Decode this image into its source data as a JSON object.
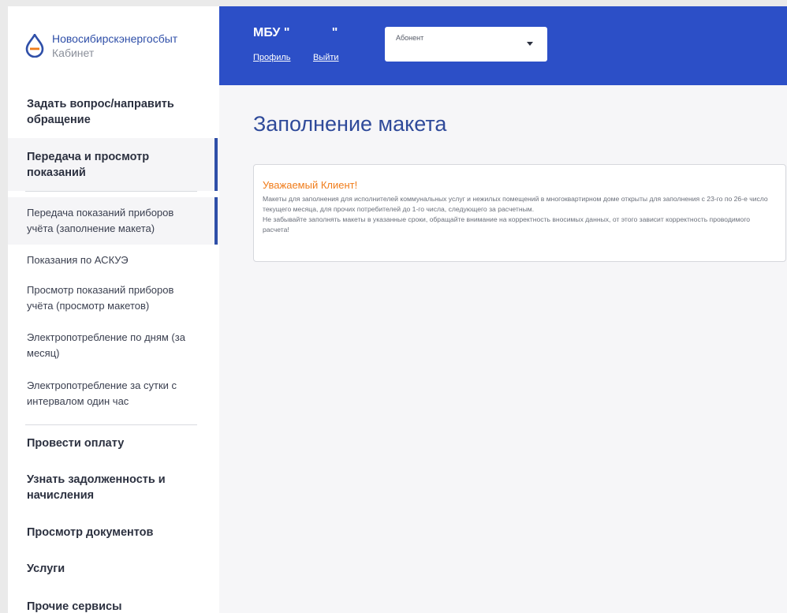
{
  "brand": {
    "name": "Новосибирскэнергосбыт",
    "subtitle": "Кабинет",
    "icon": "drop-logo-icon"
  },
  "header": {
    "org_name": "МБУ \"            \"",
    "profile_link": "Профиль",
    "logout_link": "Выйти",
    "account_select": {
      "value": "Абонент",
      "icon": "chevron-down-icon"
    }
  },
  "sidebar": {
    "ask_question": "Задать вопрос/направить обращение",
    "readings_section": "Передача и просмотр показаний",
    "sub_items": [
      "Передача показаний приборов учёта (заполнение макета)",
      "Показания по АСКУЭ",
      "Просмотр показаний приборов учёта (просмотр макетов)",
      "Электропотребление по дням (за месяц)",
      "Электропотребление за сутки с интервалом один час"
    ],
    "bottom_items": [
      "Провести оплату",
      "Узнать задолженность и начисления",
      "Просмотр документов",
      "Услуги",
      "Прочие сервисы"
    ]
  },
  "main": {
    "title": "Заполнение макета",
    "notice": {
      "title": "Уважаемый Клиент!",
      "text_1": "Макеты для заполнения для исполнителей коммунальных услуг и нежилых помещений в многоквартирном доме открыты для заполнения с 23-го по 26-е число текущего месяца, для прочих потребителей до 1-го числа, следующего за расчетным.",
      "text_2": "Не забывайте заполнять макеты в указанные сроки, обращайте внимание на корректность вносимых данных, от этого зависит корректность проводимого расчета!"
    }
  },
  "colors": {
    "header_bg": "#2c4fc7",
    "accent": "#2f4fa8",
    "notice_title": "#f07c1a"
  }
}
